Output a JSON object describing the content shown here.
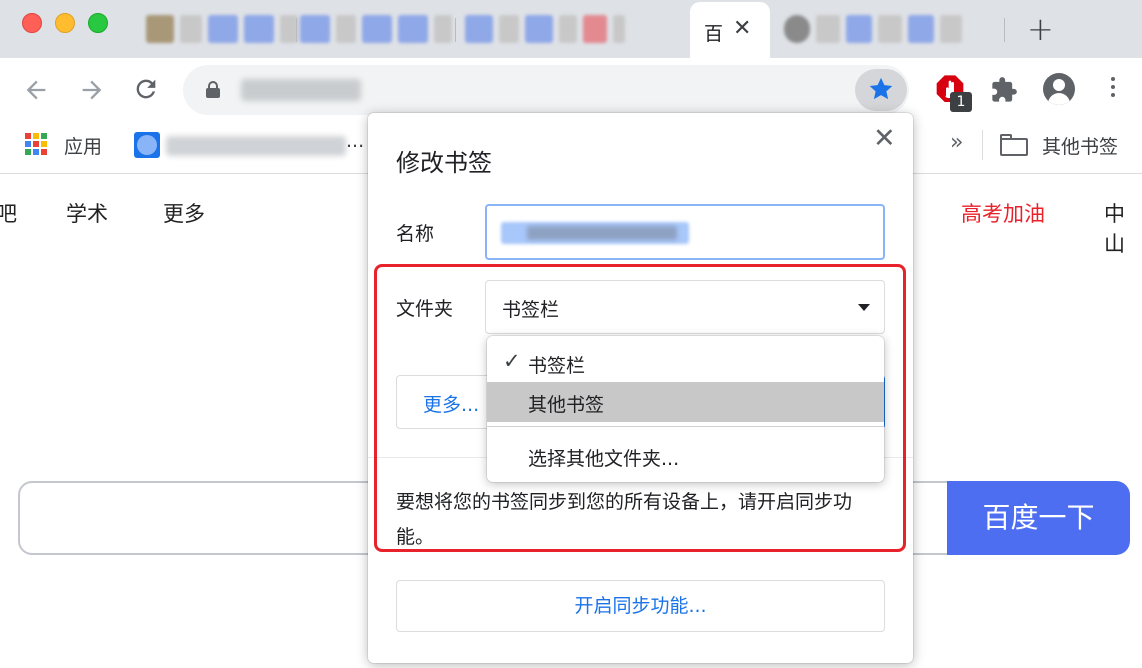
{
  "browser": {
    "active_tab_title": "百",
    "tab_close_glyph": "✕",
    "new_tab_glyph": "+",
    "extension_badge": "1",
    "bookmarks_bar": {
      "apps_label": "应用",
      "truncated_suffix": "...",
      "overflow_glyph": "»",
      "other_bookmarks_label": "其他书签"
    }
  },
  "page": {
    "nav_links": [
      "吧",
      "学术",
      "更多",
      "高考加油",
      "中山"
    ],
    "search_button": "百度一下"
  },
  "dialog": {
    "title": "修改书签",
    "close_glyph": "✕",
    "name_label": "名称",
    "folder_label": "文件夹",
    "folder_value": "书签栏",
    "more_button": "更多...",
    "sync_message": "要想将您的书签同步到您的所有设备上，请开启同步功能。",
    "sync_button": "开启同步功能..."
  },
  "dropdown": {
    "items": [
      {
        "label": "书签栏",
        "checked": true
      },
      {
        "label": "其他书签",
        "highlighted": true
      },
      {
        "label": "选择其他文件夹..."
      }
    ],
    "check_glyph": "✓"
  },
  "colors": {
    "accent_blue": "#1a73e8",
    "baidu_blue": "#4e6ef2",
    "annotation_red": "#e8212a",
    "promo_red": "#e8212a"
  }
}
